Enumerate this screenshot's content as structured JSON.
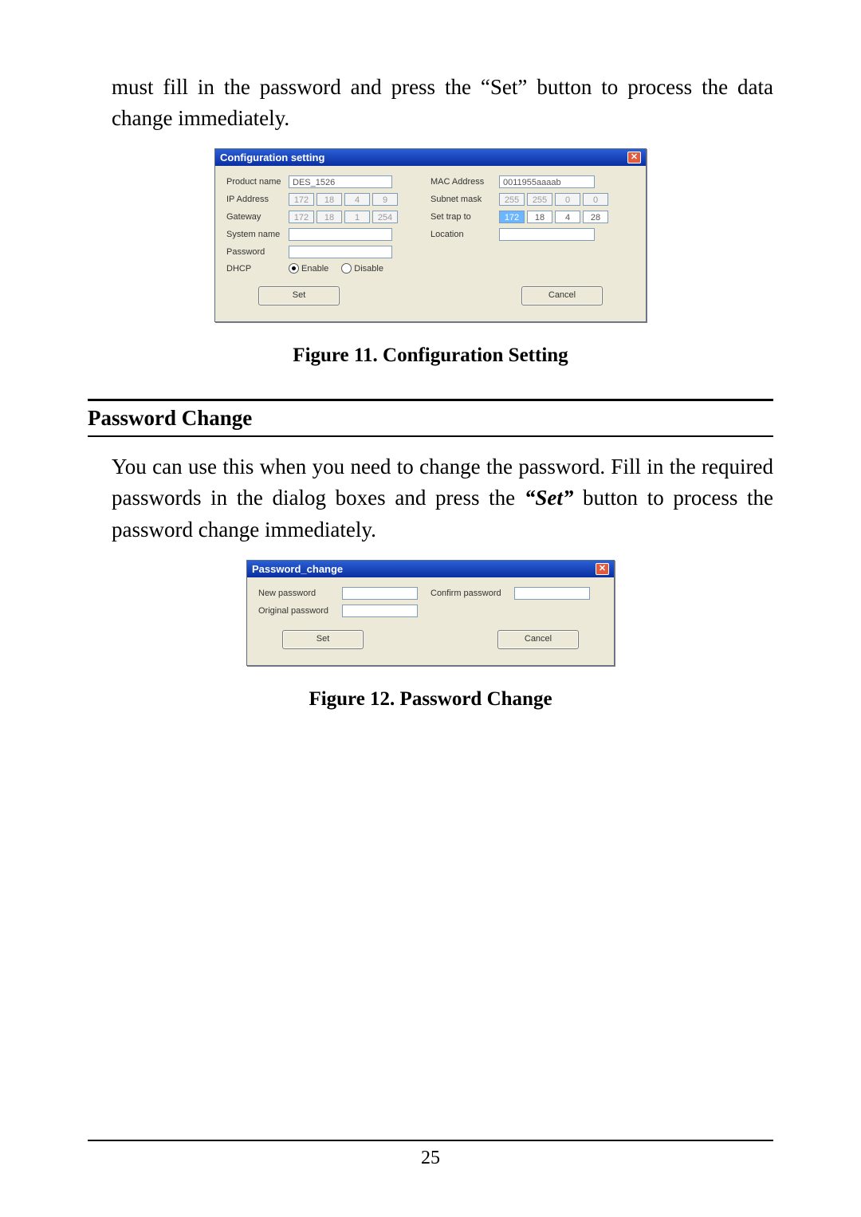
{
  "intro_text": "must fill in the password and press the “Set” button to process the data change immediately.",
  "config": {
    "title": "Configuration setting",
    "left_labels": {
      "product": "Product name",
      "ip": "IP Address",
      "gateway": "Gateway",
      "system": "System name",
      "password": "Password",
      "dhcp": "DHCP"
    },
    "right_labels": {
      "mac": "MAC Address",
      "subnet": "Subnet mask",
      "trap": "Set trap to",
      "location": "Location"
    },
    "values": {
      "product": "DES_1526",
      "ip": [
        "172",
        "18",
        "4",
        "9"
      ],
      "gateway": [
        "172",
        "18",
        "1",
        "254"
      ],
      "mac": "0011955aaaab",
      "subnet": [
        "255",
        "255",
        "0",
        "0"
      ],
      "trap": [
        "172",
        "18",
        "4",
        "28"
      ],
      "system": "",
      "password": "",
      "location": ""
    },
    "dhcp_options": {
      "enable": "Enable",
      "disable": "Disable"
    },
    "buttons": {
      "set": "Set",
      "cancel": "Cancel"
    }
  },
  "figure11_caption": "Figure 11. Configuration Setting",
  "section_heading": "Password Change",
  "pw_intro_text_pre": "You can use this when you need to change the password. Fill in the required passwords in the dialog boxes and press the ",
  "pw_intro_set_word": "“Set”",
  "pw_intro_text_post": " button to process the password change immediately.",
  "password": {
    "title": "Password_change",
    "labels": {
      "new": "New password",
      "original": "Original password",
      "confirm": "Confirm password"
    },
    "buttons": {
      "set": "Set",
      "cancel": "Cancel"
    }
  },
  "figure12_caption": "Figure 12. Password Change",
  "page_number": "25"
}
